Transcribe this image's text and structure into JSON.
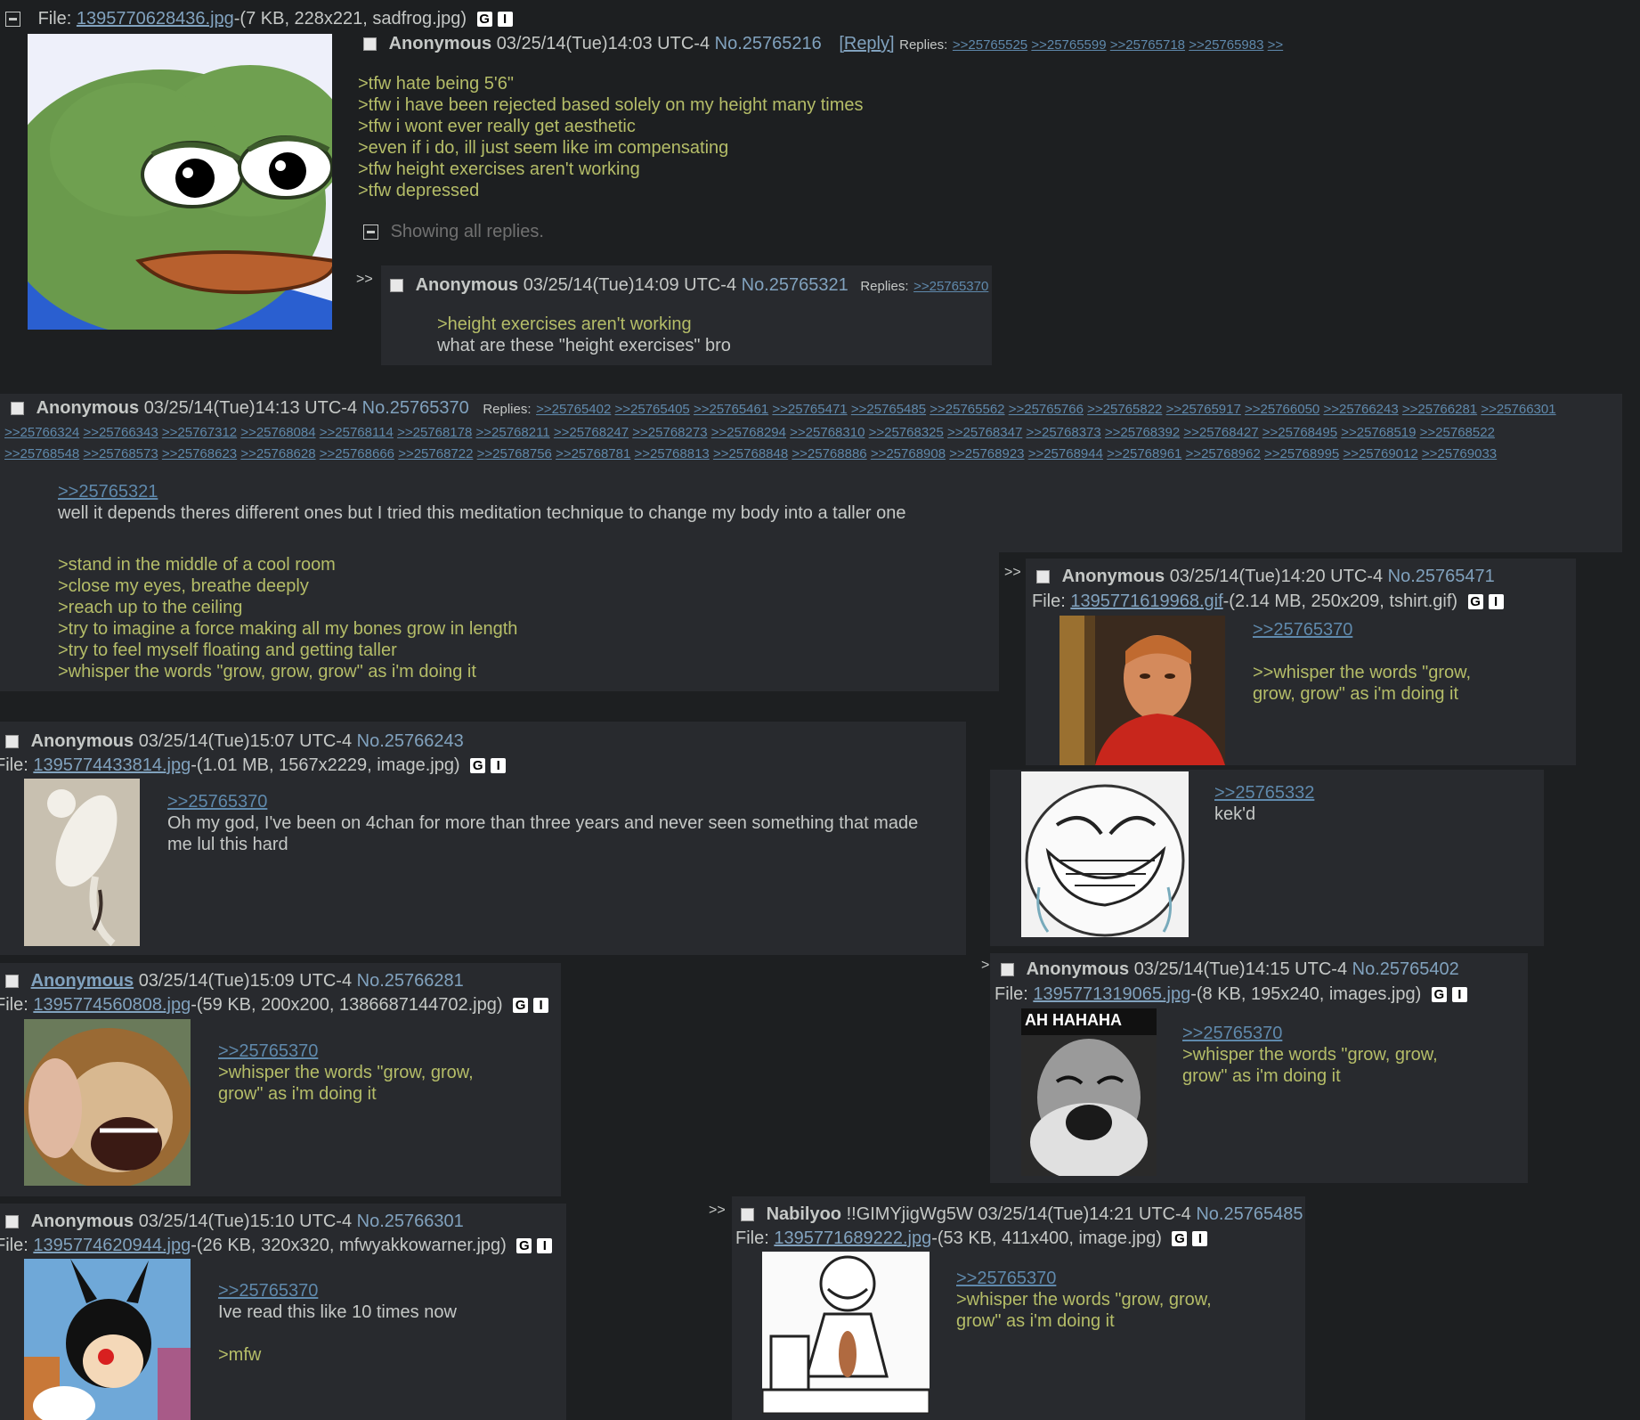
{
  "op": {
    "file_prefix": "File: ",
    "file_link": "1395770628436.jpg",
    "file_info": "-(7 KB, 228x221, sadfrog.jpg)",
    "g": "G",
    "i": "I",
    "name": "Anonymous",
    "date": "03/25/14(Tue)14:03 UTC-4",
    "no": "No.25765216",
    "reply_btn": "[Reply]",
    "replies_label": "Replies:",
    "replies": [
      ">>25765525",
      ">>25765599",
      ">>25765718",
      ">>25765983",
      ">>"
    ],
    "lines": [
      ">tfw hate being 5'6\"",
      ">tfw i have been rejected based solely on my height many times",
      ">tfw i wont ever really get aesthetic",
      ">even if i do, ill just seem like im compensating",
      ">tfw height exercises aren't working",
      ">tfw depressed"
    ],
    "showing_all": "Showing all replies."
  },
  "p321": {
    "arrows": ">>",
    "name": "Anonymous",
    "date": "03/25/14(Tue)14:09 UTC-4",
    "no": "No.25765321",
    "replies_label": "Replies:",
    "reply": ">>25765370",
    "quote": ">height exercises aren't working",
    "text": "what are these \"height exercises\" bro"
  },
  "p370": {
    "name": "Anonymous",
    "date": "03/25/14(Tue)14:13 UTC-4",
    "no": "No.25765370",
    "replies_label": "Replies:",
    "replies_row1": [
      ">>25765402",
      ">>25765405",
      ">>25765461",
      ">>25765471",
      ">>25765485",
      ">>25765562",
      ">>25765766",
      ">>25765822",
      ">>25765917",
      ">>25766050",
      ">>25766243",
      ">>25766281",
      ">>25766301"
    ],
    "replies_row2": [
      ">>25766324",
      ">>25766343",
      ">>25767312",
      ">>25768084",
      ">>25768114",
      ">>25768178",
      ">>25768211",
      ">>25768247",
      ">>25768273",
      ">>25768294",
      ">>25768310",
      ">>25768325",
      ">>25768347",
      ">>25768373",
      ">>25768392",
      ">>25768427",
      ">>25768495",
      ">>25768519",
      ">>25768522"
    ],
    "replies_row3": [
      ">>25768548",
      ">>25768573",
      ">>25768623",
      ">>25768628",
      ">>25768666",
      ">>25768722",
      ">>25768756",
      ">>25768781",
      ">>25768813",
      ">>25768848",
      ">>25768886",
      ">>25768908",
      ">>25768923",
      ">>25768944",
      ">>25768961",
      ">>25768962",
      ">>25768995",
      ">>25769012",
      ">>25769033"
    ],
    "quotelink": ">>25765321",
    "text": "well it depends theres different ones but I tried this meditation technique to change my body into a taller one",
    "lines": [
      ">stand in the middle of a cool room",
      ">close my eyes, breathe deeply",
      ">reach up to the ceiling",
      ">try to imagine a force making all my bones grow in length",
      ">try to feel myself floating and getting taller",
      ">whisper the words \"grow, grow, grow\" as i'm doing it"
    ]
  },
  "p471": {
    "arrows": ">>",
    "name": "Anonymous",
    "date": "03/25/14(Tue)14:20 UTC-4",
    "no": "No.25765471",
    "file_prefix": "File: ",
    "file_link": "1395771619968.gif",
    "file_info": "-(2.14 MB, 250x209, tshirt.gif)",
    "g": "G",
    "i": "I",
    "quotelink": ">>25765370",
    "lines": [
      ">>whisper the words \"grow,",
      "grow, grow\" as i'm doing it"
    ]
  },
  "pkek": {
    "quotelink": ">>25765332",
    "text": "kek'd"
  },
  "p243": {
    "name": "Anonymous",
    "date": "03/25/14(Tue)15:07 UTC-4",
    "no": "No.25766243",
    "file_prefix": "File: ",
    "file_link": "1395774433814.jpg",
    "file_info": "-(1.01 MB, 1567x2229, image.jpg)",
    "g": "G",
    "i": "I",
    "quotelink": ">>25765370",
    "lines": [
      "Oh my god, I've been on 4chan for more than three years and never seen something that made",
      "me lul this hard"
    ]
  },
  "p402": {
    "arrows": ">",
    "name": "Anonymous",
    "date": "03/25/14(Tue)14:15 UTC-4",
    "no": "No.25765402",
    "file_prefix": "File: ",
    "file_link": "1395771319065.jpg",
    "file_info": "-(8 KB, 195x240, images.jpg)",
    "g": "G",
    "i": "I",
    "thumb_caption": "AH HAHAHA",
    "quotelink": ">>25765370",
    "lines": [
      ">whisper the words \"grow, grow,",
      "grow\" as i'm doing it"
    ]
  },
  "p281": {
    "name": "Anonymous",
    "date": "03/25/14(Tue)15:09 UTC-4",
    "no": "No.25766281",
    "file_prefix": "File: ",
    "file_link": "1395774560808.jpg",
    "file_info": "-(59 KB, 200x200, 1386687144702.jpg)",
    "g": "G",
    "i": "I",
    "quotelink": ">>25765370",
    "lines": [
      ">whisper the words \"grow, grow,",
      "grow\" as i'm doing it"
    ]
  },
  "p301": {
    "name": "Anonymous",
    "date": "03/25/14(Tue)15:10 UTC-4",
    "no": "No.25766301",
    "file_prefix": "File: ",
    "file_link": "1395774620944.jpg",
    "file_info": "-(26 KB, 320x320, mfwyakkowarner.jpg)",
    "g": "G",
    "i": "I",
    "quotelink": ">>25765370",
    "text": "Ive read this like 10 times now",
    "mfw": ">mfw"
  },
  "p485": {
    "arrows": ">>",
    "name": "Nabilyoo",
    "trip": "!!GIMYjigWg5W",
    "date": "03/25/14(Tue)14:21 UTC-4",
    "no": "No.25765485",
    "file_prefix": "File: ",
    "file_link": "1395771689222.jpg",
    "file_info": "-(53 KB, 411x400, image.jpg)",
    "g": "G",
    "i": "I",
    "quotelink": ">>25765370",
    "lines": [
      ">whisper the words \"grow, grow,",
      "grow\" as i'm doing it"
    ]
  },
  "edge_fragments": [
    "File:",
    "File:",
    "File:"
  ]
}
